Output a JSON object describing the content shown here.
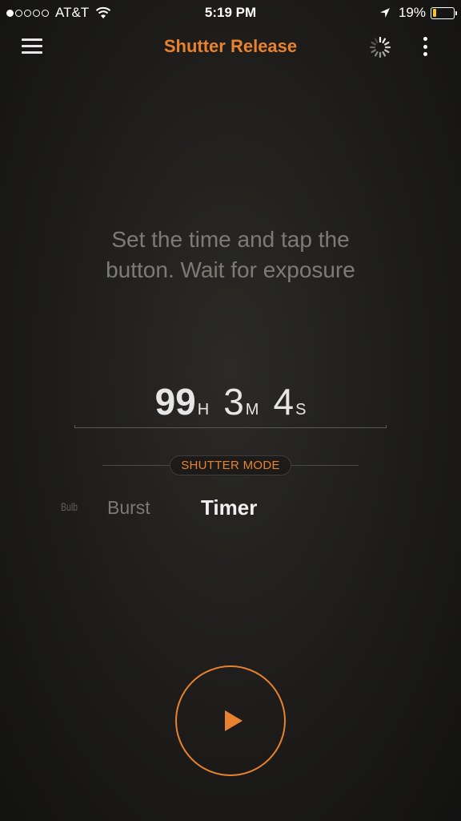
{
  "status_bar": {
    "carrier": "AT&T",
    "signal_bars_filled": 1,
    "signal_bars_total": 5,
    "time": "5:19 PM",
    "battery_percent": "19%",
    "battery_fill_fraction": 0.19,
    "colors": {
      "battery_fill": "#f5c518"
    }
  },
  "nav": {
    "title": "Shutter Release",
    "menu_icon": "hamburger-menu-icon",
    "activity_icon": "loading-spinner-icon",
    "more_icon": "vertical-ellipsis-icon"
  },
  "instruction": "Set the time and tap the button. Wait for exposure",
  "timer": {
    "hours": "99",
    "hours_unit": "H",
    "minutes": "3",
    "minutes_unit": "M",
    "seconds": "4",
    "seconds_unit": "S"
  },
  "shutter_mode": {
    "label": "SHUTTER MODE",
    "options": [
      "Bulb",
      "Burst",
      "Timer"
    ],
    "selected": "Timer"
  },
  "start_button": {
    "icon": "play-icon"
  },
  "colors": {
    "accent": "#e8822e",
    "text_muted": "#7c7b78",
    "background": "#1d1c1a"
  }
}
